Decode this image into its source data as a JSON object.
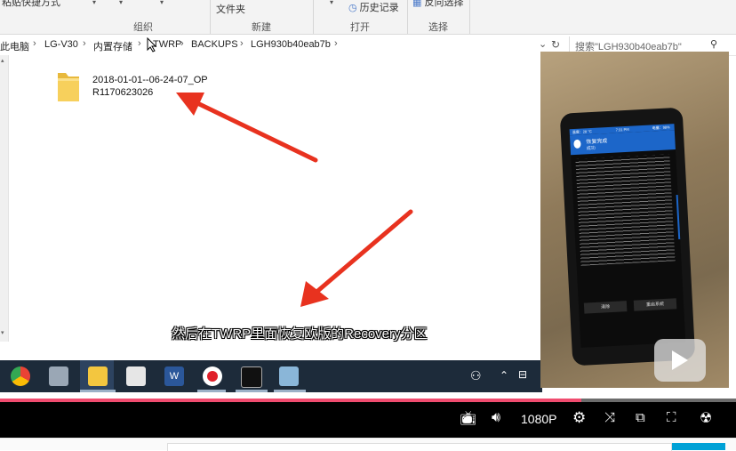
{
  "ribbon": {
    "paste_shortcut": "粘贴快捷方式",
    "group_organize": "组织",
    "folder": "文件夹",
    "group_new": "新建",
    "history": "历史记录",
    "group_open": "打开",
    "invert_selection": "反向选择",
    "group_select": "选择"
  },
  "breadcrumb": {
    "items": [
      "此电脑",
      "LG-V30",
      "内置存储",
      "TWRP",
      "BACKUPS",
      "LGH930b40eab7b"
    ]
  },
  "search": {
    "placeholder": "搜索\"LGH930b40eab7b\""
  },
  "file": {
    "name_line1": "2018-01-01--06-24-07_OP",
    "name_line2": "R1170623026"
  },
  "subtitle": "然后在TWRP里面恢复欧版的Recovery分区",
  "player": {
    "quality": "1080P",
    "progress": 0.79,
    "accent_color": "#f04c6f"
  },
  "phone": {
    "status_left": "温度：28 °C",
    "status_time": "7:31 PM",
    "status_battery": "电量：98%",
    "title": "恢复完成",
    "subtitle": "成功",
    "btn_left": "清除",
    "btn_right": "重启系统"
  }
}
